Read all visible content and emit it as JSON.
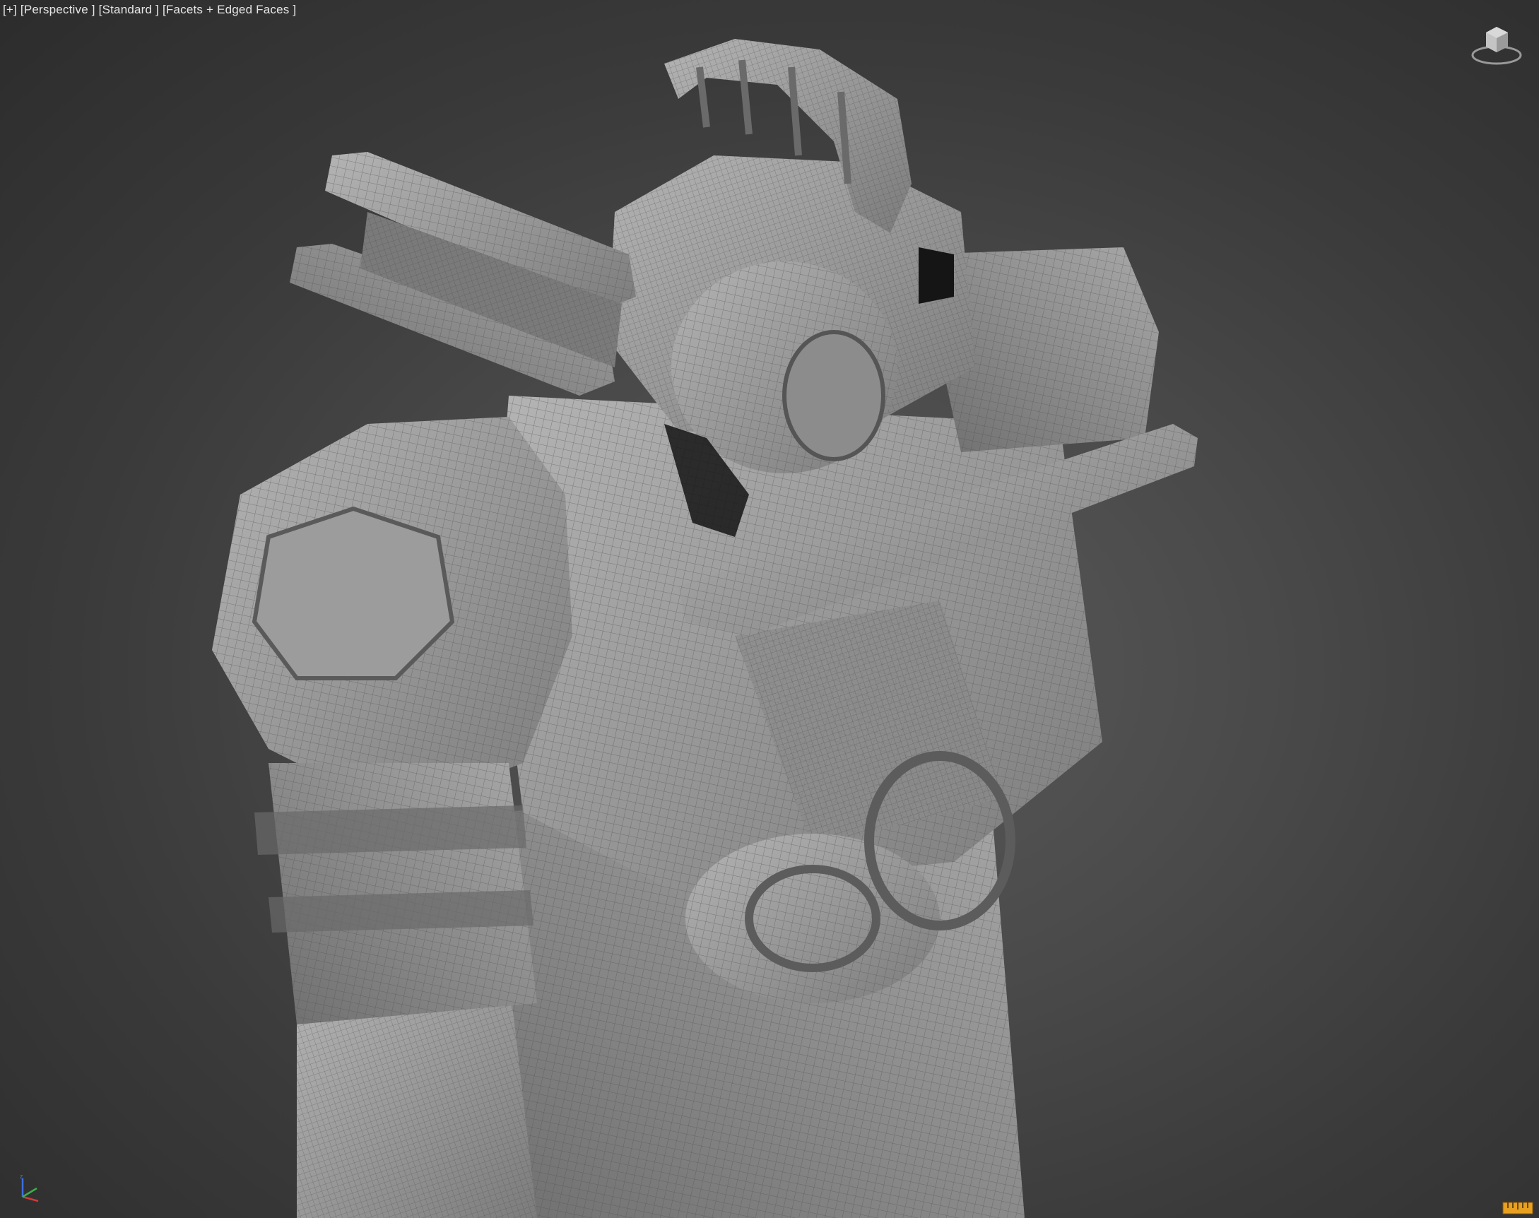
{
  "viewport": {
    "label_parts": [
      "[+]",
      "[Perspective ]",
      "[Standard ]",
      "[Facets + Edged Faces ]"
    ],
    "view_mode": "Perspective",
    "shading": "Facets + Edged Faces"
  },
  "icons": {
    "viewcube": "viewcube-icon",
    "axis": "axis-tripod-icon",
    "grid": "grid-toggle-icon"
  },
  "colors": {
    "background_center": "#5a5a5a",
    "background_edge": "#2c2c2c",
    "mesh_fill": "#9a9a9a",
    "mesh_edge": "#5c5c5c",
    "grid_toggle": "#e8a020"
  }
}
